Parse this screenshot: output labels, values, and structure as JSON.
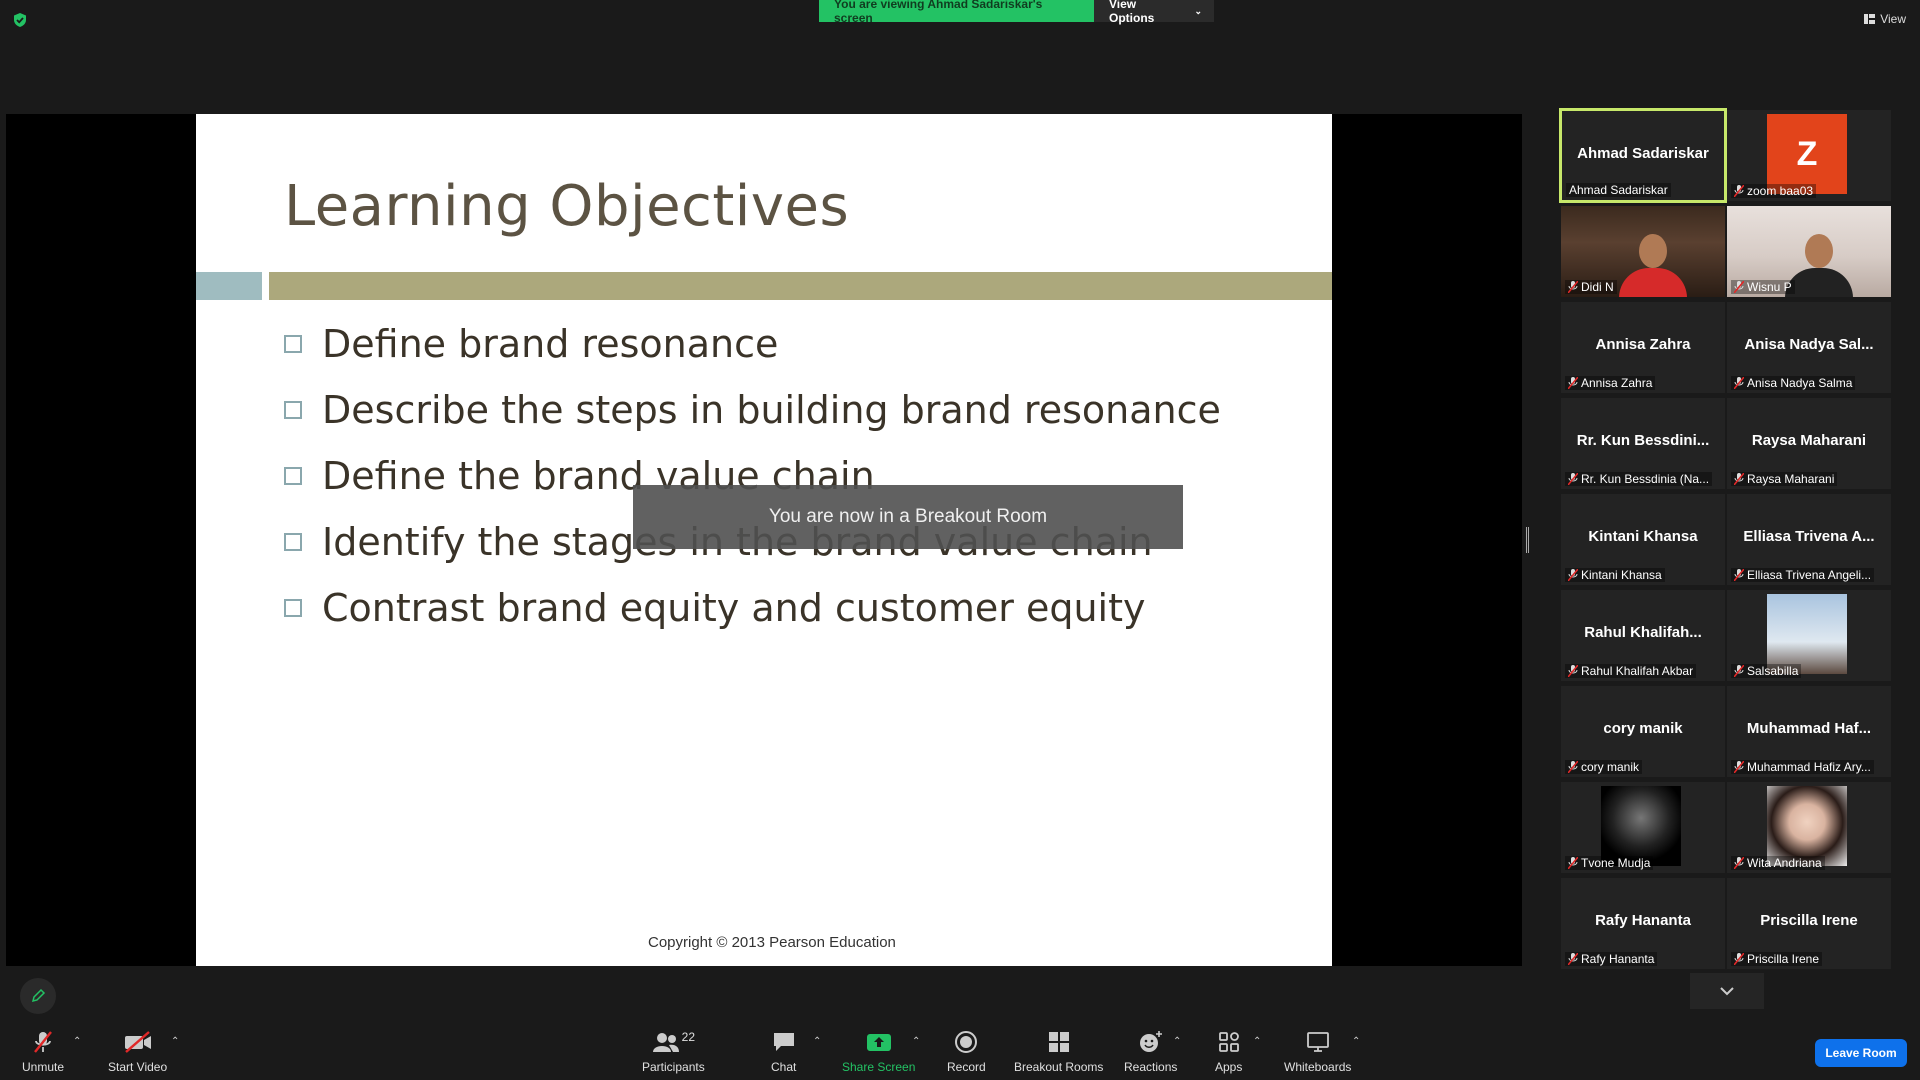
{
  "banner": {
    "viewing_text": "You are viewing Ahmad Sadariskar's screen",
    "view_options": "View Options",
    "view_label": "View"
  },
  "slide": {
    "title": "Learning Objectives",
    "bullets": [
      "Define brand resonance",
      "Describe the steps in building brand resonance",
      "Define the brand value chain",
      "Identify the stages in the brand value chain",
      "Contrast brand equity and customer equity"
    ],
    "copyright": "Copyright © 2013  Pearson Education"
  },
  "toast": "You are now in a Breakout Room",
  "participants": [
    {
      "big": "Ahmad Sadariskar",
      "label": "Ahmad Sadariskar",
      "muted": false,
      "active": true
    },
    {
      "big": "",
      "label": "zoom baa03",
      "muted": true,
      "avatar_letter": "Z"
    },
    {
      "big": "",
      "label": "Didi N",
      "muted": true,
      "video": true
    },
    {
      "big": "",
      "label": "Wisnu P",
      "muted": true,
      "video": true
    },
    {
      "big": "Annisa Zahra",
      "label": "Annisa Zahra",
      "muted": true
    },
    {
      "big": "Anisa Nadya Sal...",
      "label": "Anisa Nadya Salma",
      "muted": true
    },
    {
      "big": "Rr. Kun Bessdini...",
      "label": "Rr. Kun Bessdinia (Na...",
      "muted": true
    },
    {
      "big": "Raysa Maharani",
      "label": "Raysa Maharani",
      "muted": true
    },
    {
      "big": "Kintani Khansa",
      "label": "Kintani Khansa",
      "muted": true
    },
    {
      "big": "Elliasa Trivena A...",
      "label": "Elliasa Trivena Angeli...",
      "muted": true
    },
    {
      "big": "Rahul  Khalifah...",
      "label": "Rahul Khalifah Akbar",
      "muted": true
    },
    {
      "big": "",
      "label": "Salsabilla",
      "muted": true,
      "photo": true
    },
    {
      "big": "cory manik",
      "label": "cory manik",
      "muted": true
    },
    {
      "big": "Muhammad  Haf...",
      "label": "Muhammad Hafiz Ary...",
      "muted": true
    },
    {
      "big": "",
      "label": "Tvone Mudja",
      "muted": true,
      "photo": true
    },
    {
      "big": "",
      "label": "Wita Andriana",
      "muted": true,
      "photo": true
    },
    {
      "big": "Rafy Hananta",
      "label": "Rafy Hananta",
      "muted": true
    },
    {
      "big": "Priscilla Irene",
      "label": "Priscilla Irene",
      "muted": true
    }
  ],
  "toolbar": {
    "unmute": "Unmute",
    "start_video": "Start Video",
    "participants": "Participants",
    "participants_count": "22",
    "chat": "Chat",
    "share_screen": "Share Screen",
    "record": "Record",
    "breakout_rooms": "Breakout Rooms",
    "reactions": "Reactions",
    "apps": "Apps",
    "whiteboards": "Whiteboards",
    "leave_room": "Leave Room"
  },
  "colors": {
    "banner_green": "#23c264",
    "active_border": "#c7e86a",
    "share_green": "#23c264",
    "leave_blue": "#0e71eb",
    "avatar_orange": "#e2441b",
    "muted_red": "#e02828"
  }
}
